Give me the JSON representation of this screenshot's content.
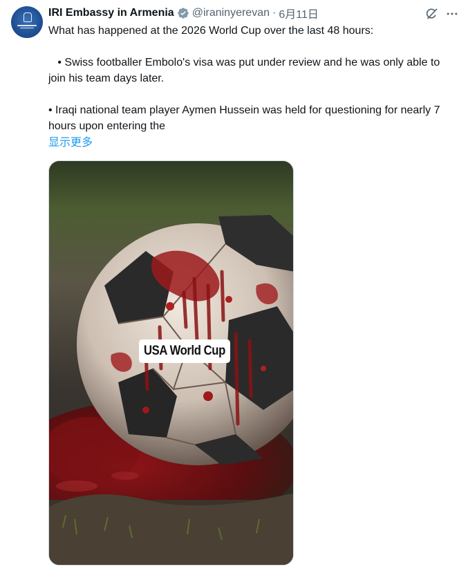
{
  "author": {
    "name": "IRI Embassy in Armenia",
    "handle": "@iraninyerevan",
    "separator": "·",
    "date": "6月11日",
    "verified_badge": "verified-gray-icon"
  },
  "actions": {
    "grok_icon": "grok-icon",
    "more_icon": "more-icon"
  },
  "post": {
    "line1": "What has happened at the 2026 World Cup over the last 48 hours:",
    "bullet1": "   • Swiss footballer Embolo's visa was put under review and he was only able to join his team days later.",
    "bullet2": "• Iraqi national team player Aymen Hussein was held for questioning for nearly 7 hours upon entering the",
    "show_more": "显示更多"
  },
  "media": {
    "caption_label": "USA World Cup"
  },
  "colors": {
    "text": "#0f1419",
    "secondary": "#536471",
    "link": "#1d9bf0",
    "border": "#cfd9de",
    "verified": "#829aab"
  }
}
